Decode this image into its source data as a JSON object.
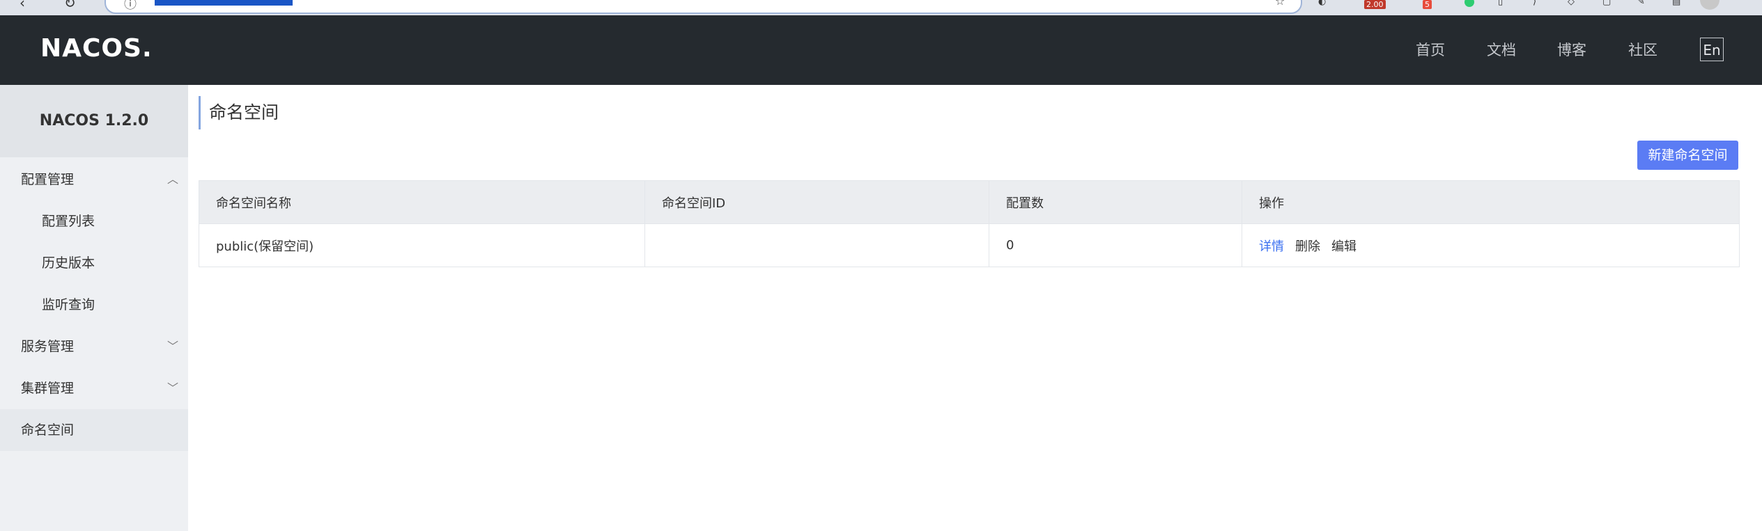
{
  "browser": {
    "extension_badges": [
      {
        "label": "2.00",
        "color": "#c0392b"
      },
      {
        "label": "5",
        "color": "#e74c3c"
      }
    ]
  },
  "header": {
    "logo": "NACOS.",
    "nav": [
      "首页",
      "文档",
      "博客",
      "社区"
    ],
    "lang_button": "En"
  },
  "sidebar": {
    "version": "NACOS 1.2.0",
    "groups": [
      {
        "label": "配置管理",
        "expanded": true,
        "children": [
          "配置列表",
          "历史版本",
          "监听查询"
        ]
      },
      {
        "label": "服务管理",
        "expanded": false
      },
      {
        "label": "集群管理",
        "expanded": false
      },
      {
        "label": "命名空间",
        "active": true
      }
    ]
  },
  "main": {
    "title": "命名空间",
    "create_button": "新建命名空间",
    "table": {
      "columns": [
        "命名空间名称",
        "命名空间ID",
        "配置数",
        "操作"
      ],
      "rows": [
        {
          "name": "public(保留空间)",
          "id": "",
          "config_count": "0",
          "actions": [
            "详情",
            "删除",
            "编辑"
          ]
        }
      ]
    }
  },
  "colors": {
    "header_bg": "#252a2f",
    "sidebar_bg": "#eef0f3",
    "primary_button": "#5b7cf4",
    "link": "#3a6ff0"
  }
}
